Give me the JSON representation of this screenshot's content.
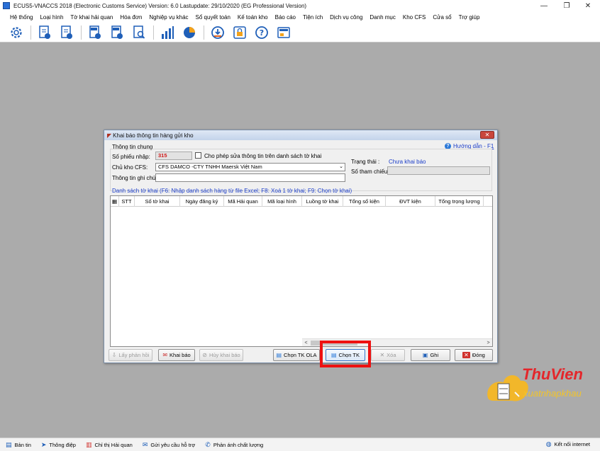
{
  "window": {
    "title": "ECUS5-VNACCS 2018 (Electronic Customs Service) Version: 6.0 Lastupdate: 29/10/2020 (EG Professional Version)",
    "minimize": "—",
    "restore": "❐",
    "close": "✕"
  },
  "menu": [
    "Hệ thống",
    "Loại hình",
    "Tờ khai hải quan",
    "Hóa đơn",
    "Nghiệp vụ khác",
    "Sổ quyết toán",
    "Kế toán kho",
    "Báo cáo",
    "Tiện ích",
    "Dịch vụ công",
    "Danh mục",
    "Kho CFS",
    "Cửa sổ",
    "Trợ giúp"
  ],
  "toolbar_icons": [
    "gear-icon",
    "doc-import-icon",
    "doc-export-icon",
    "ida-icon",
    "eda-icon",
    "search-doc-icon",
    "bar-chart-icon",
    "pie-chart-icon",
    "download-icon",
    "lock-icon",
    "help-icon",
    "card-icon"
  ],
  "dialog": {
    "title": "Khai báo thông tin hàng gửi kho",
    "close": "✕",
    "group_title": "Thông tin chung",
    "help_link": "Hướng dẫn - F1",
    "so_phieu_label": "Số phiếu nhập:",
    "so_phieu_value": "315",
    "allow_edit_label": "Cho phép sửa thông tin trên danh sách tờ khai",
    "chu_kho_label": "Chủ kho CFS:",
    "chu_kho_value": "CFS DAMCO -CTY TNHH Maersk Việt Nam",
    "ghi_chu_label": "Thông tin ghi chú:",
    "ghi_chu_value": "",
    "trang_thai_label": "Trạng thái :",
    "trang_thai_value": "Chưa khai báo",
    "so_tham_chieu_label": "Số tham chiếu:",
    "so_tham_chieu_value": "",
    "list_title": "Danh sách tờ khai (F6: Nhập danh sách hàng từ file Excel; F8: Xoá 1 tờ khai; F9: Chọn tờ khai)",
    "columns": [
      "STT",
      "Số tờ khai",
      "Ngày đăng ký",
      "Mã Hải quan",
      "Mã loại hình",
      "Luồng tờ khai",
      "Tổng số kiện",
      "ĐVT kiện",
      "Tổng trọng lượng"
    ],
    "scroll_left": "<",
    "scroll_right": ">",
    "buttons": {
      "lay_phan_hoi": "Lấy phản hồi",
      "khai_bao": "Khai báo",
      "huy_khai_bao": "Hủy khai báo",
      "chon_tk_ola": "Chọn TK OLA",
      "chon_tk": "Chọn TK",
      "xoa": "Xóa",
      "ghi": "Ghi",
      "dong": "Đóng"
    }
  },
  "statusbar": {
    "items": [
      "Bản tin",
      "Thông điệp",
      "Chỉ thị Hải quan",
      "Gửi yêu cầu hỗ trợ",
      "Phản ánh chất lượng"
    ],
    "connection": "Kết nối internet"
  },
  "watermark": {
    "line1": "ThuVien",
    "line2": "xuatnhapkhau"
  },
  "colors": {
    "mdi_background": "#ababab",
    "highlight": "#ee1111",
    "link": "#1a3cc8",
    "so_phieu": "#d01818"
  }
}
